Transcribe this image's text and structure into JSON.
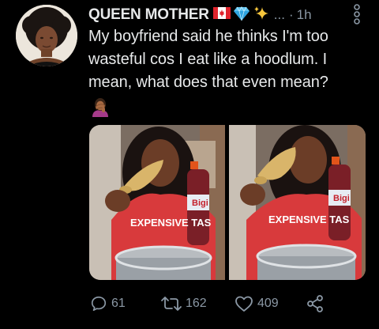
{
  "tweet": {
    "display_name": "QUEEN MOTHER",
    "ellipsis": "...",
    "separator": "·",
    "time": "1h",
    "text": "My boyfriend said he thinks I'm too wasteful cos I eat like a hoodlum. I mean, what does that even mean?",
    "name_emojis": [
      "canada-flag-icon",
      "gem-icon",
      "sparkles-icon"
    ],
    "text_emoji": "woman-facepalming-icon"
  },
  "media": {
    "photos": [
      {
        "shirt_text": "EXPENSIVE TAS",
        "bottle_label": "Bigi"
      },
      {
        "shirt_text": "EXPENSIVE TAS",
        "bottle_label": "Bigi"
      }
    ]
  },
  "actions": {
    "replies": "61",
    "retweets": "162",
    "likes": "409"
  },
  "colors": {
    "background": "#000000",
    "text": "#e7e9ea",
    "muted": "#8b98a5"
  }
}
